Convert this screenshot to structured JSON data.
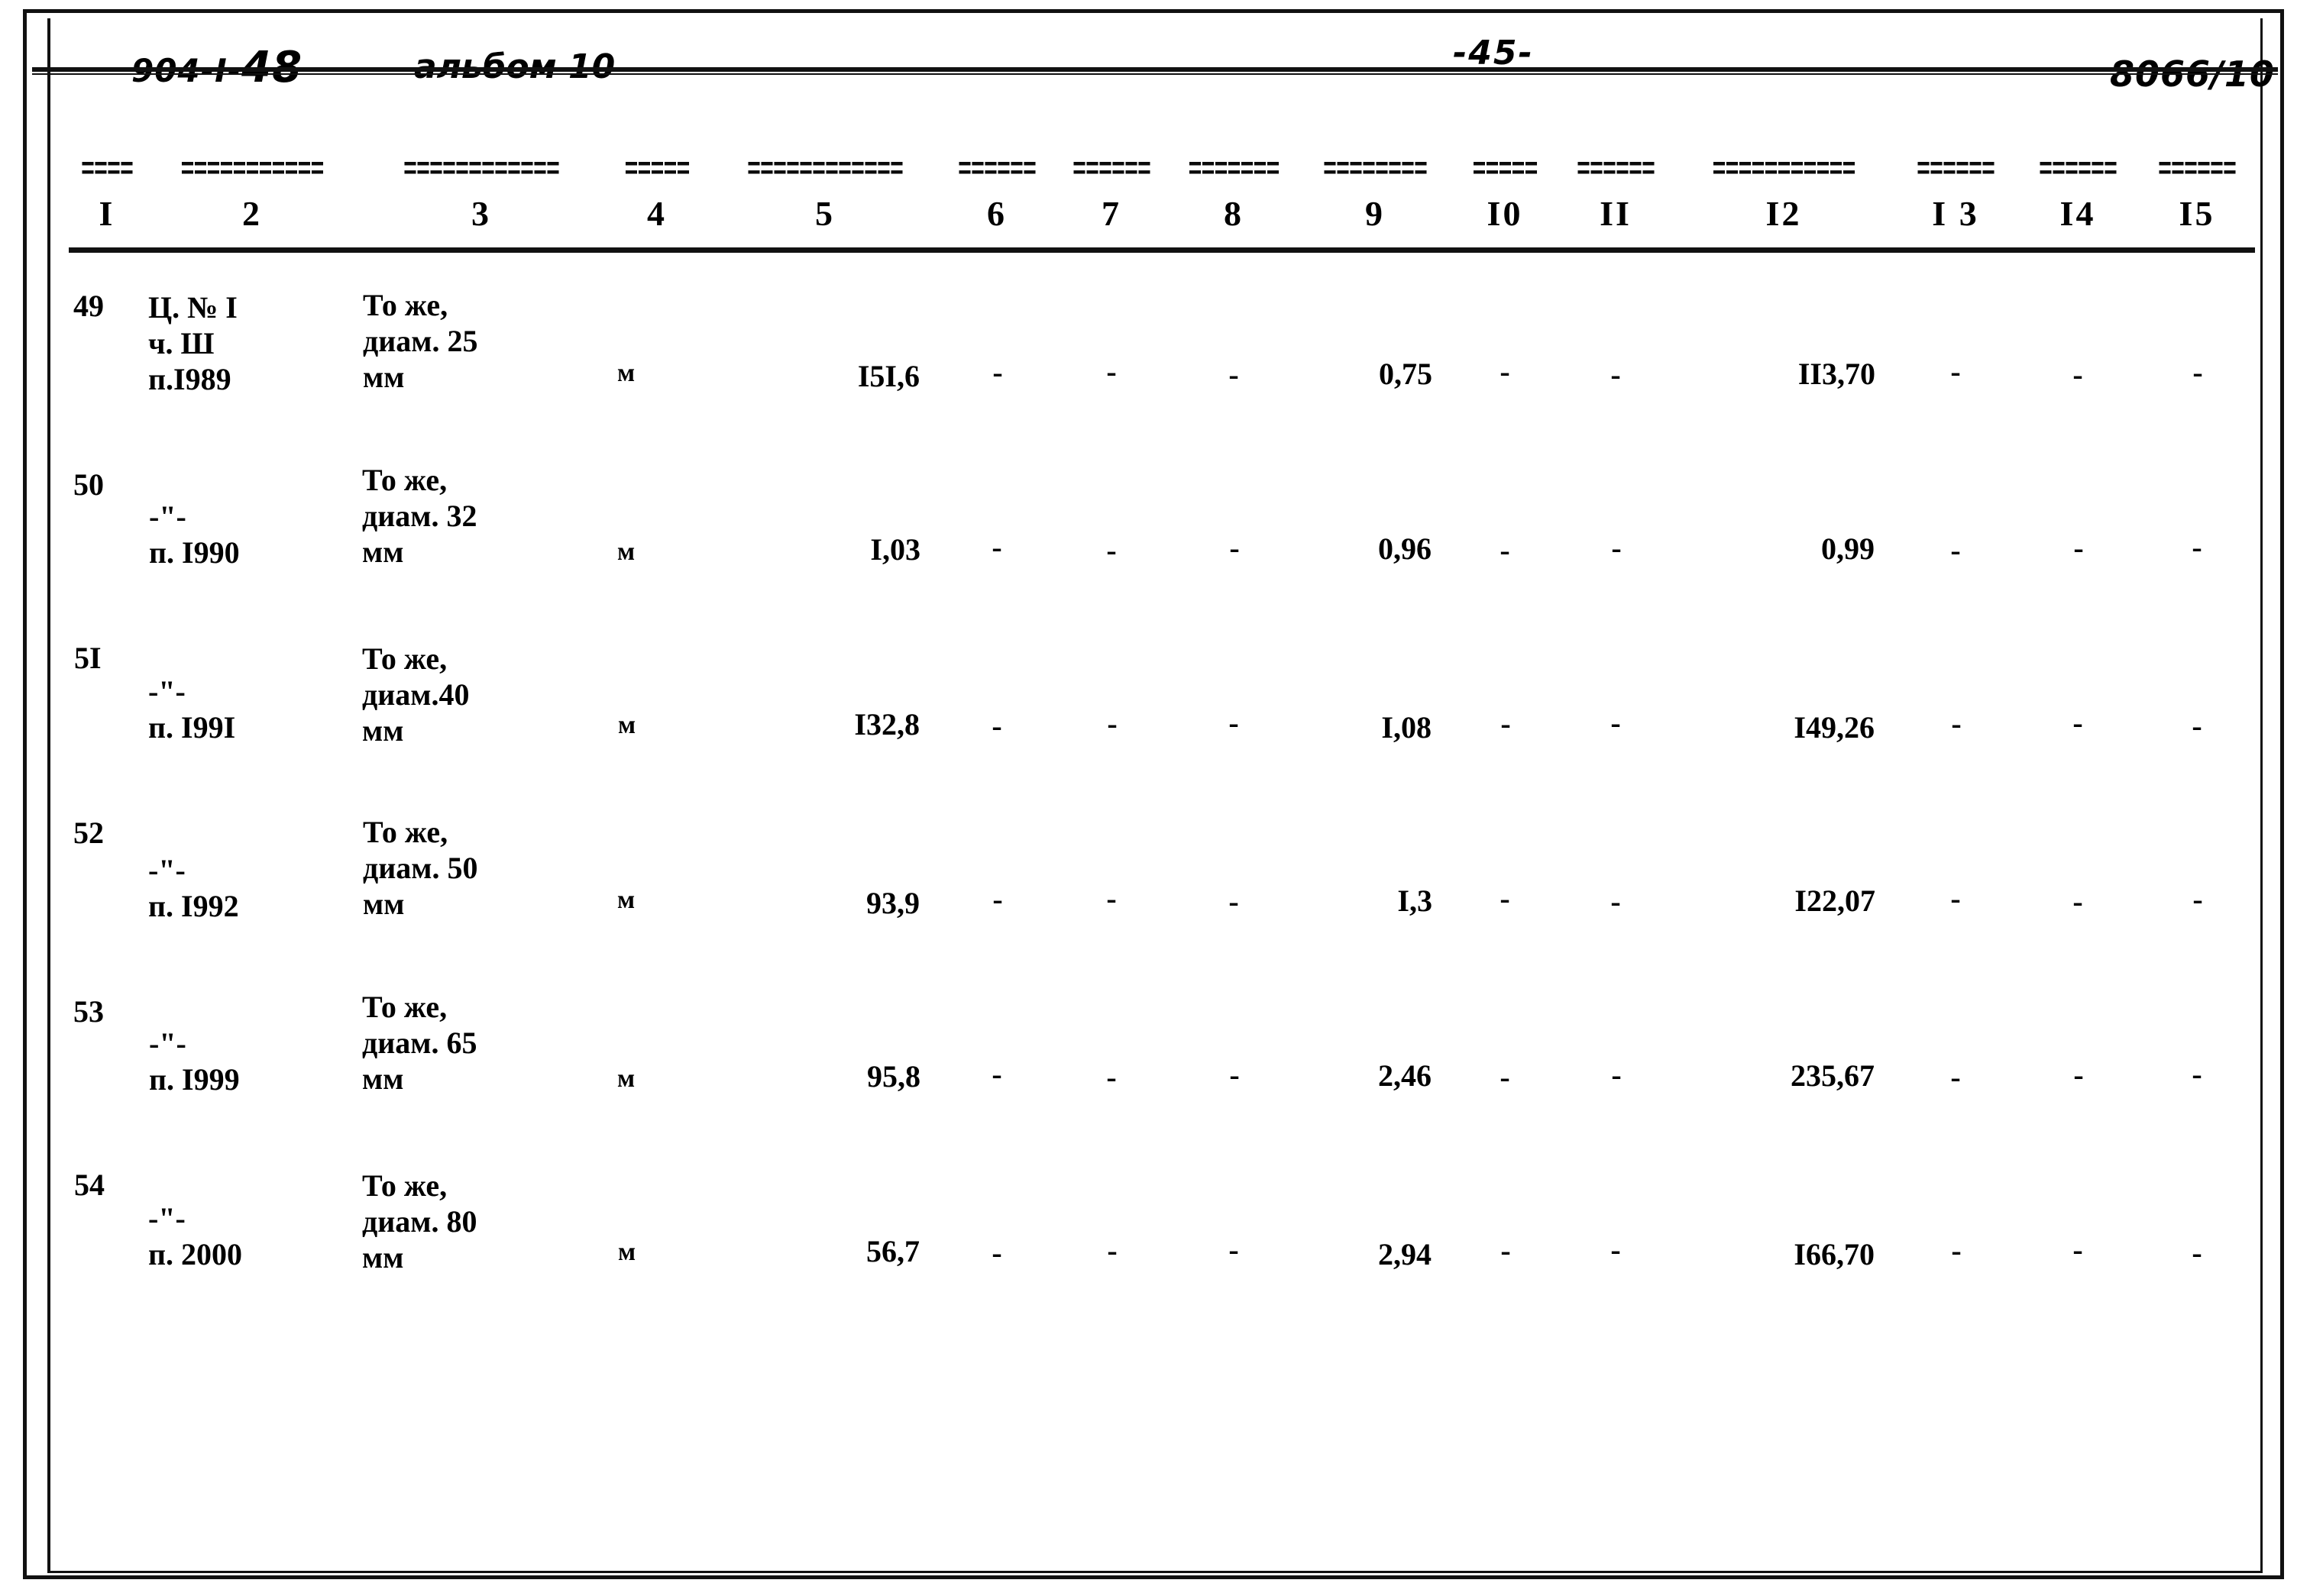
{
  "header": {
    "doc_code_prefix": "904-I-",
    "doc_code_suffix": "48",
    "album": "альбом 10",
    "page_number": "-45-",
    "doc_id": "8066/10"
  },
  "table": {
    "separator_mark": "=====",
    "column_numbers": [
      "I",
      "2",
      "3",
      "4",
      "5",
      "6",
      "7",
      "8",
      "9",
      "I0",
      "II",
      "I2",
      "I 3",
      "I4",
      "I5"
    ],
    "rows": [
      {
        "num": "49",
        "position": "Ц. № I\nч. Ш\nп.I989",
        "name": "То же,\nдиам. 25\nмм",
        "unit": "м",
        "c5": "I5I,6",
        "c6": "-",
        "c7": "-",
        "c8": "-",
        "c9": "0,75",
        "c10": "-",
        "c11": "-",
        "c12": "II3,70",
        "c13": "-",
        "c14": "-",
        "c15": "-"
      },
      {
        "num": "50",
        "position": "-\"-\nп. I990",
        "name": "То же,\nдиам. 32\nмм",
        "unit": "м",
        "c5": "I,03",
        "c6": "-",
        "c7": "-",
        "c8": "-",
        "c9": "0,96",
        "c10": "-",
        "c11": "-",
        "c12": "0,99",
        "c13": "-",
        "c14": "-",
        "c15": "-"
      },
      {
        "num": "5I",
        "position": "-\"-\nп. I99I",
        "name": "То же,\nдиам.40\nмм",
        "unit": "м",
        "c5": "I32,8",
        "c6": "-",
        "c7": "-",
        "c8": "-",
        "c9": "I,08",
        "c10": "-",
        "c11": "-",
        "c12": "I49,26",
        "c13": "-",
        "c14": "-",
        "c15": "-"
      },
      {
        "num": "52",
        "position": "-\"-\nп. I992",
        "name": "То же,\nдиам. 50\nмм",
        "unit": "м",
        "c5": "93,9",
        "c6": "-",
        "c7": "-",
        "c8": "-",
        "c9": "I,3",
        "c10": "-",
        "c11": "-",
        "c12": "I22,07",
        "c13": "-",
        "c14": "-",
        "c15": "-"
      },
      {
        "num": "53",
        "position": "-\"-\nп. I999",
        "name": "То же,\nдиам. 65\nмм",
        "unit": "м",
        "c5": "95,8",
        "c6": "-",
        "c7": "-",
        "c8": "-",
        "c9": "2,46",
        "c10": "-",
        "c11": "-",
        "c12": "235,67",
        "c13": "-",
        "c14": "-",
        "c15": "-"
      },
      {
        "num": "54",
        "position": "-\"-\nп. 2000",
        "name": "То же,\nдиам. 80\nмм",
        "unit": "м",
        "c5": "56,7",
        "c6": "-",
        "c7": "-",
        "c8": "-",
        "c9": "2,94",
        "c10": "-",
        "c11": "-",
        "c12": "I66,70",
        "c13": "-",
        "c14": "-",
        "c15": "-"
      }
    ]
  },
  "colors": {
    "ink": "#000000",
    "paper": "#ffffff"
  }
}
